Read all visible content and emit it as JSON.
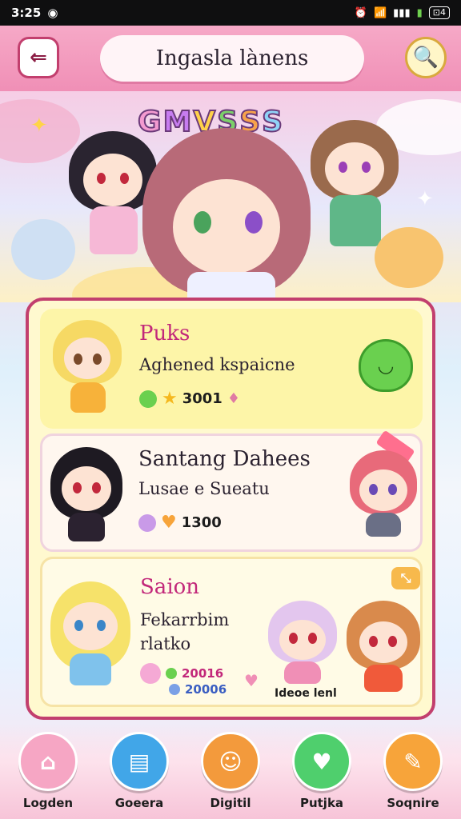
{
  "status_bar": {
    "time": "3:25",
    "battery": "⊡4"
  },
  "header": {
    "title": "Ingasla lànens",
    "back_icon": "back-icon",
    "search_icon": "search-icon"
  },
  "hero": {
    "logo_letters": [
      "G",
      "M",
      "V",
      "S",
      "S",
      "S"
    ],
    "logo_colors": [
      "#f39ad0",
      "#c77cf0",
      "#ffd24a",
      "#7bd06a",
      "#f7a24b",
      "#8fd3f6"
    ]
  },
  "cards": [
    {
      "title": "Puks",
      "subtitle": "Aghened kspaicne",
      "stat_value": "3001",
      "title_color": "#c2287a"
    },
    {
      "title": "Santang Dahees",
      "subtitle": "Lusae e Sueatu",
      "stat_value": "1300",
      "title_color": "#2b2230"
    },
    {
      "title": "Saion",
      "subtitle": "Fekarrbim",
      "subtitle2": "rlatko",
      "stat_value_a": "20016",
      "stat_value_b": "20006",
      "card_label": "Ideoe lenl",
      "title_color": "#c2287a"
    }
  ],
  "nav": [
    {
      "label": "Logden",
      "icon": "home-icon",
      "color": "#f6a6c4"
    },
    {
      "label": "Goeera",
      "icon": "calendar-icon",
      "color": "#41a6e8"
    },
    {
      "label": "Digitil",
      "icon": "chat-icon",
      "color": "#f39a3c"
    },
    {
      "label": "Putjka",
      "icon": "heart-icon",
      "color": "#4fcf6d"
    },
    {
      "label": "Soqnire",
      "icon": "gift-icon",
      "color": "#f7a43a"
    }
  ]
}
